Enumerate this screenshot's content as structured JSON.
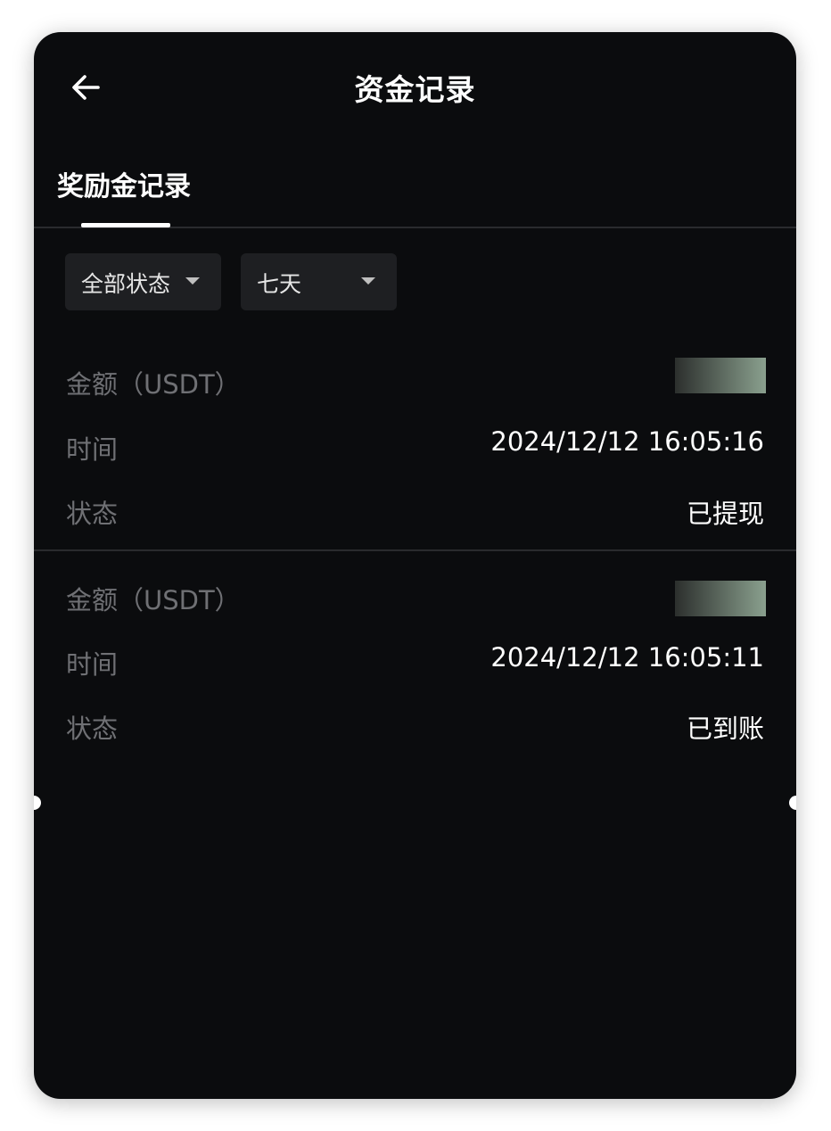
{
  "header": {
    "title": "资金记录",
    "back_icon": "arrow-left-icon"
  },
  "tabs": [
    {
      "label": "奖励金记录",
      "active": true
    }
  ],
  "filters": {
    "status": {
      "selected": "全部状态"
    },
    "period": {
      "selected": "七天"
    }
  },
  "records": [
    {
      "amount_label": "金额（USDT）",
      "amount_value": "redacted",
      "time_label": "时间",
      "time_value": "2024/12/12 16:05:16",
      "status_label": "状态",
      "status_value": "已提现"
    },
    {
      "amount_label": "金额（USDT）",
      "amount_value": "redacted",
      "time_label": "时间",
      "time_value": "2024/12/12 16:05:11",
      "status_label": "状态",
      "status_value": "已到账"
    }
  ],
  "colors": {
    "background": "#0b0c0e",
    "text_primary": "#ffffff",
    "text_secondary": "#6f7074",
    "divider": "#2a2b2e",
    "filter_bg": "#1e1f22",
    "mask_start": "#2c2f2d",
    "mask_end": "#8aa08e"
  }
}
